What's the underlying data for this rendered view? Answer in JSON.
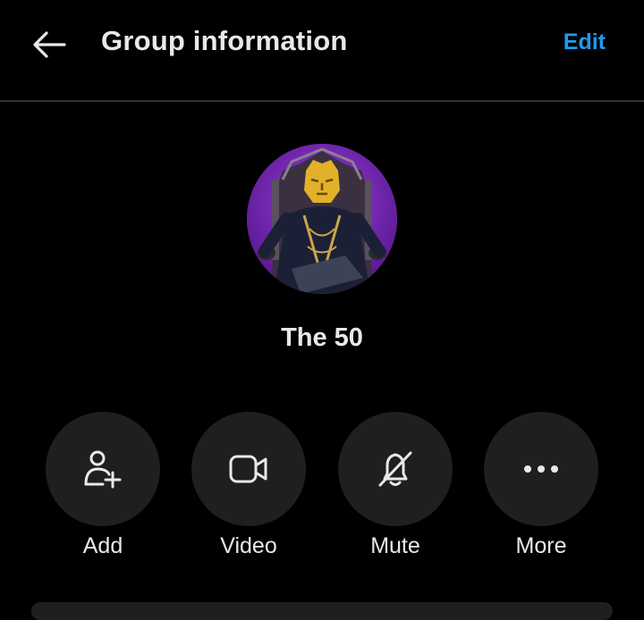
{
  "header": {
    "back_icon": "arrow-left-icon",
    "title": "Group information",
    "edit_label": "Edit"
  },
  "group": {
    "name": "The 50"
  },
  "actions": [
    {
      "label": "Add",
      "icon": "add-person-icon"
    },
    {
      "label": "Video",
      "icon": "video-camera-icon"
    },
    {
      "label": "Mute",
      "icon": "bell-muted-icon"
    },
    {
      "label": "More",
      "icon": "more-dots-icon"
    }
  ],
  "colors": {
    "background": "#000000",
    "text": "#e7e9ea",
    "accent": "#1d9bf0",
    "button_bg": "#1f1f1f",
    "divider": "#2f3336"
  }
}
